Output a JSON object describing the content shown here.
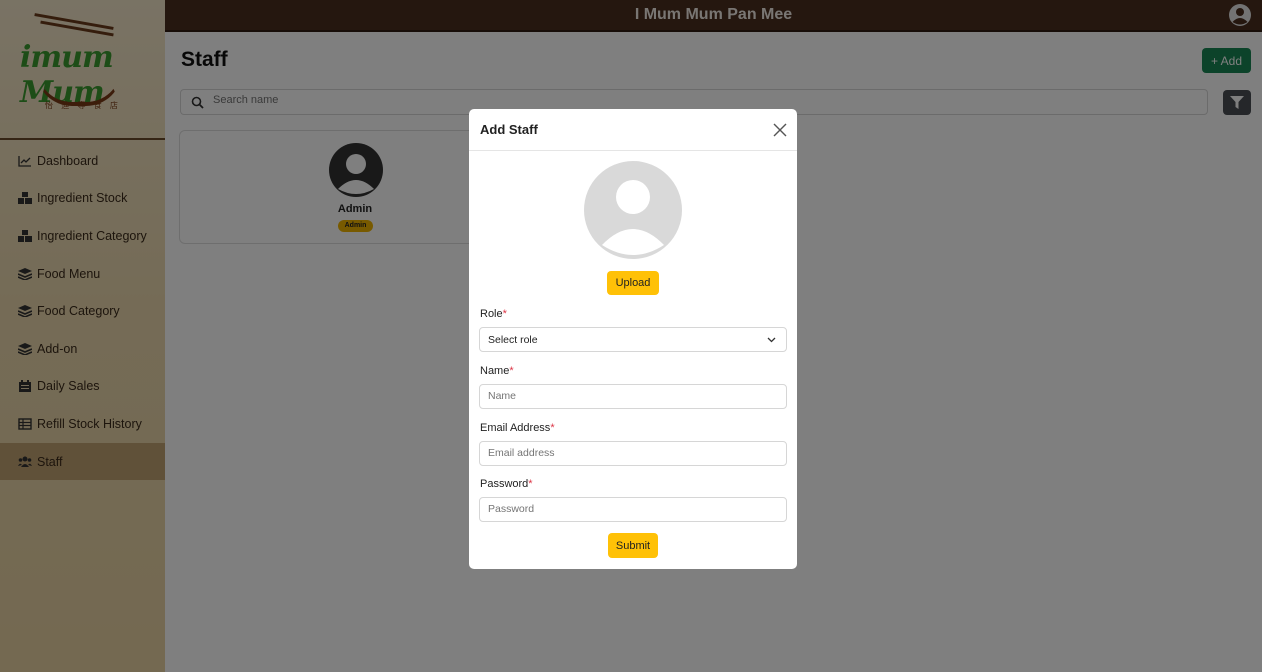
{
  "app": {
    "title": "I Mum Mum Pan Mee"
  },
  "logo": {
    "text": "imum Mum",
    "sub": "怡 迪 專 食 店"
  },
  "sidebar": {
    "items": [
      {
        "label": "Dashboard",
        "icon": "chart-line-icon"
      },
      {
        "label": "Ingredient Stock",
        "icon": "boxes-icon"
      },
      {
        "label": "Ingredient Category",
        "icon": "boxes-icon"
      },
      {
        "label": "Food Menu",
        "icon": "layers-icon"
      },
      {
        "label": "Food Category",
        "icon": "layers-icon"
      },
      {
        "label": "Add-on",
        "icon": "layers-icon"
      },
      {
        "label": "Daily Sales",
        "icon": "calendar-icon"
      },
      {
        "label": "Refill Stock History",
        "icon": "table-icon"
      },
      {
        "label": "Staff",
        "icon": "users-icon",
        "active": true
      }
    ]
  },
  "page": {
    "title": "Staff",
    "add_label": "+ Add",
    "search_placeholder": "Search name"
  },
  "staff_list": [
    {
      "name": "Admin",
      "role": "Admin"
    }
  ],
  "modal": {
    "title": "Add Staff",
    "upload_label": "Upload",
    "role_label": "Role",
    "role_value": "Select role",
    "name_label": "Name",
    "name_placeholder": "Name",
    "email_label": "Email Address",
    "email_placeholder": "Email address",
    "password_label": "Password",
    "password_placeholder": "Password",
    "required_mark": "*",
    "submit_label": "Submit"
  },
  "colors": {
    "header": "#4a2e1f",
    "accent_yellow": "#ffc107",
    "add_green": "#198754",
    "sidebar_active": "#c8a46e"
  }
}
